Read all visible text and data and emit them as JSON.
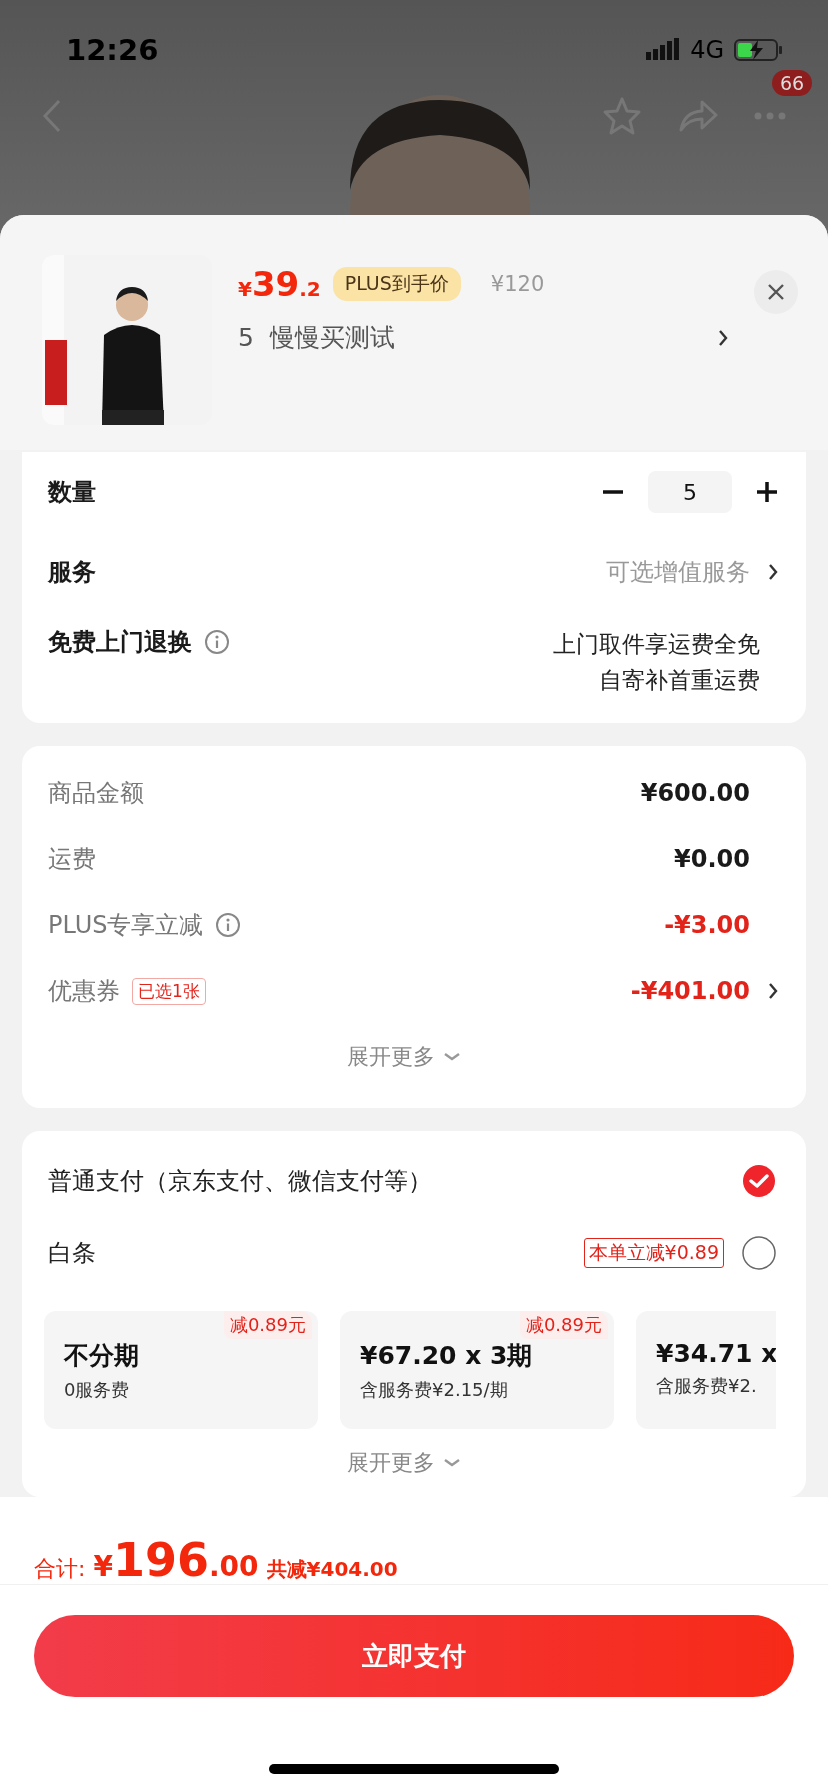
{
  "status_bar": {
    "time": "12:26",
    "network": "4G"
  },
  "nav": {
    "badge": "66"
  },
  "product": {
    "price": {
      "symbol": "¥",
      "integer": "39",
      "decimal": ".2"
    },
    "plus_tag": "PLUS到手价",
    "original_price": "¥120",
    "spec": "5  慢慢买测试"
  },
  "options": {
    "quantity": {
      "label": "数量",
      "value": "5"
    },
    "service": {
      "label": "服务",
      "value": "可选增值服务"
    },
    "return": {
      "label": "免费上门退换",
      "lines": [
        "上门取件享运费全免",
        "自寄补首重运费"
      ]
    }
  },
  "amounts": {
    "rows": [
      {
        "label": "商品金额",
        "value": "¥600.00",
        "kind": "normal",
        "info": false,
        "arrow": false
      },
      {
        "label": "运费",
        "value": "¥0.00",
        "kind": "normal",
        "info": false,
        "arrow": false
      },
      {
        "label": "PLUS专享立减",
        "value": "-¥3.00",
        "kind": "discount",
        "info": true,
        "arrow": false
      },
      {
        "label": "优惠券",
        "tag": "已选1张",
        "value": "-¥401.00",
        "kind": "discount",
        "info": false,
        "arrow": true
      }
    ],
    "expand": "展开更多"
  },
  "payment": {
    "methods": [
      {
        "label": "普通支付（京东支付、微信支付等）",
        "selected": true
      },
      {
        "label": "白条",
        "tag": "本单立减¥0.89",
        "selected": false
      }
    ],
    "installments": [
      {
        "badge": "减0.89元",
        "title": "不分期",
        "sub": "0服务费"
      },
      {
        "badge": "减0.89元",
        "title": "¥67.20 x 3期",
        "sub": "含服务费¥2.15/期"
      },
      {
        "title": "¥34.71 x",
        "sub": "含服务费¥2."
      }
    ],
    "expand": "展开更多"
  },
  "footer": {
    "total_label": "合计:",
    "symbol": "¥",
    "integer": "196",
    "decimal": ".00",
    "saved": "共减¥404.00",
    "pay_button": "立即支付"
  }
}
